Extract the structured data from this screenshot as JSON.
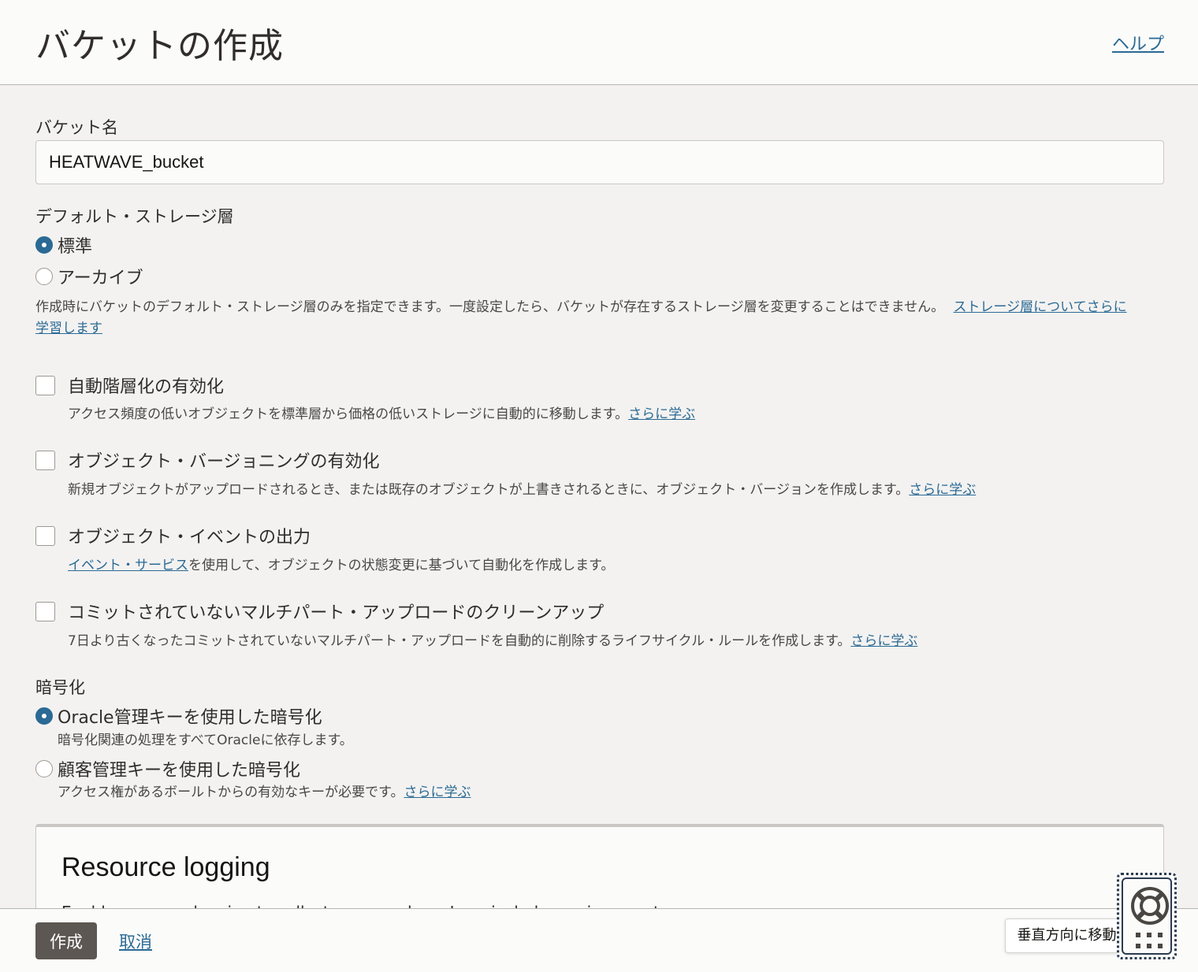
{
  "header": {
    "title": "バケットの作成",
    "help_link": "ヘルプ"
  },
  "bucket_name": {
    "label": "バケット名",
    "value": "HEATWAVE_bucket"
  },
  "storage_tier": {
    "label": "デフォルト・ストレージ層",
    "options": [
      {
        "label": "標準",
        "selected": true
      },
      {
        "label": "アーカイブ",
        "selected": false
      }
    ],
    "help_text": "作成時にバケットのデフォルト・ストレージ層のみを指定できます。一度設定したら、バケットが存在するストレージ層を変更することはできません。",
    "help_link_part1": "ストレージ層についてさらに",
    "help_link_part2": "学習します"
  },
  "options": [
    {
      "label": "自動階層化の有効化",
      "checked": false,
      "desc": "アクセス頻度の低いオブジェクトを標準層から価格の低いストレージに自動的に移動します。",
      "link": "さらに学ぶ"
    },
    {
      "label": "オブジェクト・バージョニングの有効化",
      "checked": false,
      "desc": "新規オブジェクトがアップロードされるとき、または既存のオブジェクトが上書きされるときに、オブジェクト・バージョンを作成します。",
      "link": "さらに学ぶ"
    },
    {
      "label": "オブジェクト・イベントの出力",
      "checked": false,
      "desc_link": "イベント・サービス",
      "desc": "を使用して、オブジェクトの状態変更に基づいて自動化を作成します。"
    },
    {
      "label": "コミットされていないマルチパート・アップロードのクリーンアップ",
      "checked": false,
      "desc": "7日より古くなったコミットされていないマルチパート・アップロードを自動的に削除するライフサイクル・ルールを作成します。",
      "link": "さらに学ぶ"
    }
  ],
  "encryption": {
    "label": "暗号化",
    "options": [
      {
        "label": "Oracle管理キーを使用した暗号化",
        "selected": true,
        "desc": "暗号化関連の処理をすべてOracleに依存します。"
      },
      {
        "label": "顧客管理キーを使用した暗号化",
        "selected": false,
        "desc": "アクセス権があるボールトからの有効なキーが必要です。",
        "link": "さらに学ぶ"
      }
    ]
  },
  "resource_logging": {
    "title": "Resource logging",
    "desc": "Enable resource logging to collect resource logs. Logs include service events"
  },
  "footer": {
    "create_label": "作成",
    "cancel_label": "取消",
    "tooltip": "垂直方向に移動"
  },
  "colors": {
    "accent": "#2b6a94",
    "primary_button": "#5c5752",
    "background": "#f3f2f1"
  }
}
